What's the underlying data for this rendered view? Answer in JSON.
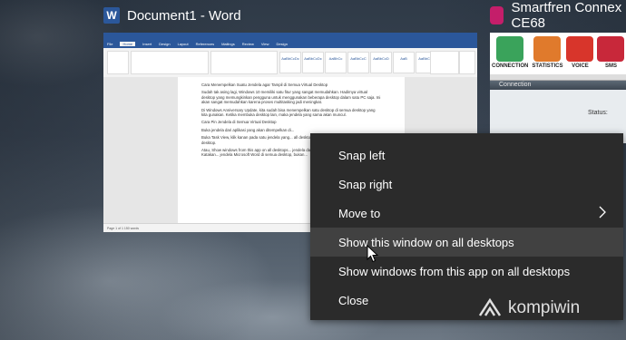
{
  "word_window": {
    "icon": "word-icon",
    "icon_letter": "W",
    "title": "Document1 - Word",
    "ribbon_tabs": [
      "File",
      "Home",
      "Insert",
      "Design",
      "Layout",
      "References",
      "Mailings",
      "Review",
      "View",
      "Design"
    ],
    "active_tab": "Home",
    "styles": [
      "AaBbCcDc",
      "AaBbCcDc",
      "AaBbCc",
      "AaBbCcC",
      "AaBbCcD",
      "AaB",
      "AaBbCcC"
    ],
    "document_paragraphs": [
      "Cara Menempelkan Suatu Jendela agar Tampil di Semua Virtual Desktop",
      "Sudah tak asing lagi, Windows 10 memiliki satu fitur yang sangat memudahkan. Hadirnya virtual desktop yang memungkinkan pengguna untuk menggunakan beberapa desktop dalam satu PC saja. Ini akan sangat memudahkan karena proses multitasking jadi meningkat.",
      "Di Windows Anniversary Update, kita sudah bisa menempelkan satu desktop di semua desktop yang kita gunakan. Ketika membuka desktop lain, maka jendela yang sama akan muncul.",
      "Cara Pin Jendela di Semua Virtual Desktop",
      "Buka jendela dari aplikasi yang akan ditempelkan di...",
      "Buka Task View, klik kanan pada satu jendela yang... all desktops. Ini akan menampilkan satu jendela... desktop.",
      "Atau, Show windows from this app on all desktops... jendela dari satu aplikasi di semua desktop. Katakan... jendela Microsoft Word di semua desktop, bukan..."
    ],
    "status_text": "Page 1 of 1    150 words"
  },
  "smartfren_window": {
    "icon": "smartfren-icon",
    "title": "Smartfren Connex CE68",
    "tools": [
      {
        "label": "CONNECTION",
        "icon": "connection-icon",
        "color": "#3aa35b"
      },
      {
        "label": "STATISTICS",
        "icon": "statistics-icon",
        "color": "#e07a2c"
      },
      {
        "label": "VOICE",
        "icon": "voice-icon",
        "color": "#d8352b"
      },
      {
        "label": "SMS",
        "icon": "sms-icon",
        "color": "#c8283a"
      }
    ],
    "section_header": "Connection",
    "status_label": "Status:"
  },
  "context_menu": {
    "items": [
      {
        "label": "Snap left"
      },
      {
        "label": "Snap right"
      },
      {
        "label": "Move to",
        "submenu": true
      },
      {
        "label": "Show this window on all desktops",
        "highlighted": true
      },
      {
        "label": "Show windows from this app on all desktops"
      },
      {
        "label": "Close"
      }
    ]
  },
  "watermark": {
    "text": "kompiwin",
    "icon": "kompiwin-logo-icon"
  },
  "colors": {
    "word_blue": "#2b579a",
    "menu_bg": "#2b2b2b",
    "menu_highlight": "#414141"
  }
}
